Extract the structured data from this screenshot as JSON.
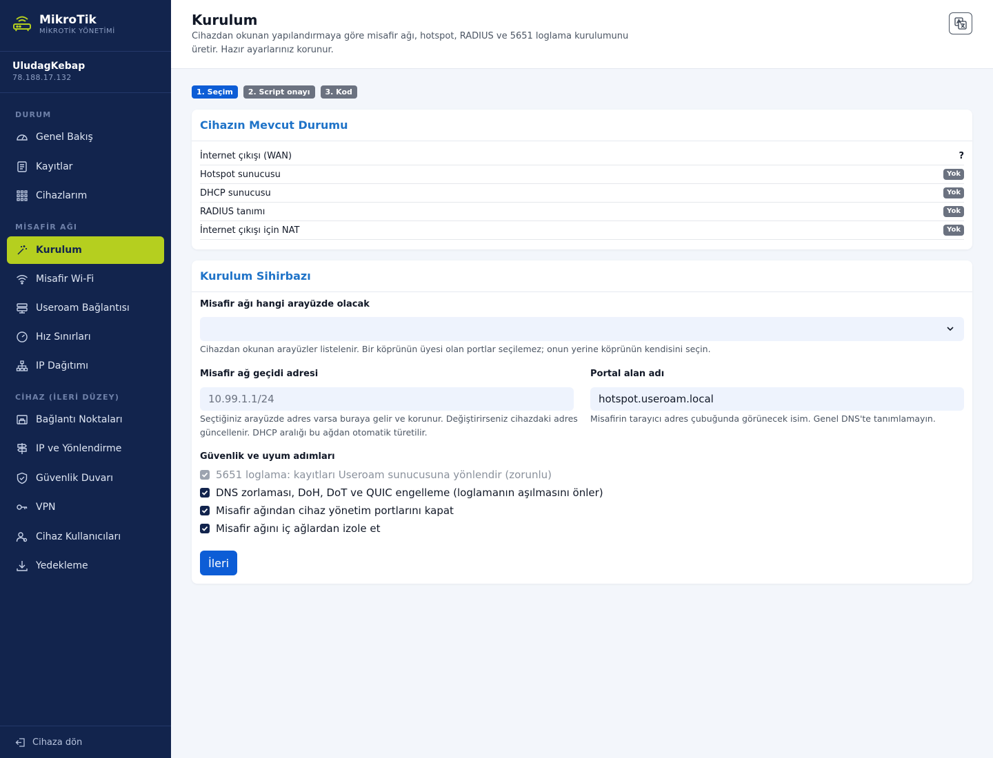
{
  "brand": {
    "name": "MikroTik",
    "subtitle": "MİKROTİK YÖNETİMİ"
  },
  "device": {
    "name": "UludagKebap",
    "ip": "78.188.17.132"
  },
  "sidebar": {
    "sections": [
      "DURUM",
      "MİSAFİR AĞI",
      "CİHAZ (İLERİ DÜZEY)"
    ],
    "items": [
      {
        "label": "Genel Bakış",
        "icon": "gauge-icon"
      },
      {
        "label": "Kayıtlar",
        "icon": "log-icon"
      },
      {
        "label": "Cihazlarım",
        "icon": "grid-icon"
      },
      {
        "label": "Kurulum",
        "icon": "magic-wand-icon",
        "active": true
      },
      {
        "label": "Misafir Wi-Fi",
        "icon": "wifi-icon"
      },
      {
        "label": "Useroam Bağlantısı",
        "icon": "server-icon"
      },
      {
        "label": "Hız Sınırları",
        "icon": "speedometer-icon"
      },
      {
        "label": "IP Dağıtımı",
        "icon": "diagram-icon"
      },
      {
        "label": "Bağlantı Noktaları",
        "icon": "ethernet-icon"
      },
      {
        "label": "IP ve Yönlendirme",
        "icon": "signpost-icon"
      },
      {
        "label": "Güvenlik Duvarı",
        "icon": "shield-icon"
      },
      {
        "label": "VPN",
        "icon": "key-icon"
      },
      {
        "label": "Cihaz Kullanıcıları",
        "icon": "users-icon"
      },
      {
        "label": "Yedekleme",
        "icon": "download-icon"
      }
    ],
    "footer": "Cihaza dön"
  },
  "header": {
    "title": "Kurulum",
    "description": "Cihazdan okunan yapılandırmaya göre misafir ağı, hotspot, RADIUS ve 5651 loglama kurulumunu üretir. Hazır ayarlarınız korunur."
  },
  "steps": [
    "1. Seçim",
    "2. Script onayı",
    "3. Kod"
  ],
  "status_card": {
    "title": "Cihazın Mevcut Durumu",
    "rows": [
      {
        "label": "İnternet çıkışı (WAN)",
        "value": "?"
      },
      {
        "label": "Hotspot sunucusu",
        "value": "Yok"
      },
      {
        "label": "DHCP sunucusu",
        "value": "Yok"
      },
      {
        "label": "RADIUS tanımı",
        "value": "Yok"
      },
      {
        "label": "İnternet çıkışı için NAT",
        "value": "Yok"
      }
    ]
  },
  "wizard": {
    "title": "Kurulum Sihirbazı",
    "interface_label": "Misafir ağı hangi arayüzde olacak",
    "interface_value": "",
    "interface_help": "Cihazdan okunan arayüzler listelenir. Bir köprünün üyesi olan portlar seçilemez; onun yerine köprünün kendisini seçin.",
    "gateway_label": "Misafir ağ geçidi adresi",
    "gateway_placeholder": "10.99.1.1/24",
    "gateway_help": "Seçtiğiniz arayüzde adres varsa buraya gelir ve korunur. Değiştirirseniz cihazdaki adres güncellenir. DHCP aralığı bu ağdan otomatik türetilir.",
    "portal_label": "Portal alan adı",
    "portal_value": "hotspot.useroam.local",
    "portal_help": "Misafirin tarayıcı adres çubuğunda görünecek isim. Genel DNS'te tanımlamayın.",
    "security_label": "Güvenlik ve uyum adımları",
    "checks": [
      {
        "label": "5651 loglama: kayıtları Useroam sunucusuna yönlendir (zorunlu)",
        "checked": true,
        "disabled": true
      },
      {
        "label": "DNS zorlaması, DoH, DoT ve QUIC engelleme (loglamanın aşılmasını önler)",
        "checked": true,
        "disabled": false
      },
      {
        "label": "Misafir ağından cihaz yönetim portlarını kapat",
        "checked": true,
        "disabled": false
      },
      {
        "label": "Misafir ağını iç ağlardan izole et",
        "checked": true,
        "disabled": false
      }
    ],
    "next_label": "İleri"
  },
  "colors": {
    "sidebar": "#12244d",
    "accent": "#b5cf1f",
    "primary": "#0d5dd6",
    "heading": "#1f73c8"
  }
}
